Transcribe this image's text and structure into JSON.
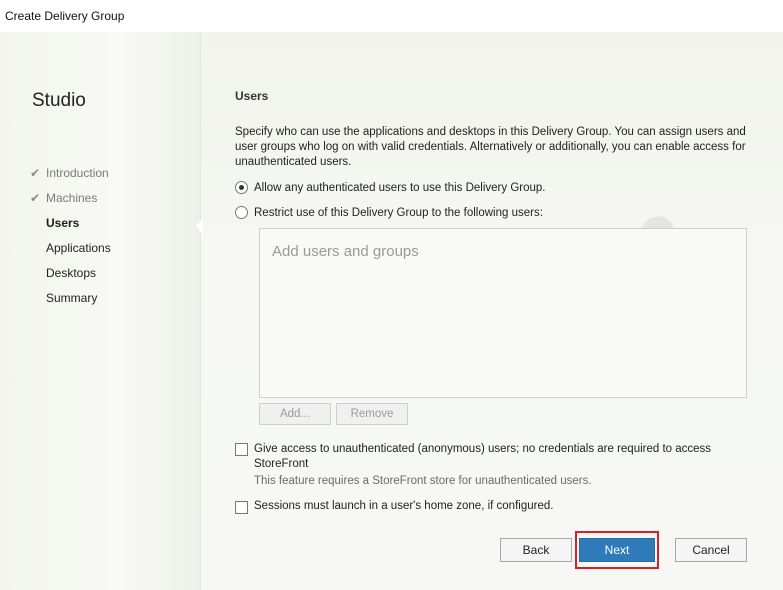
{
  "window": {
    "title": "Create Delivery Group"
  },
  "sidebar": {
    "brand": "Studio",
    "steps": [
      {
        "label": "Introduction",
        "state": "done",
        "icon": "checkmark-icon"
      },
      {
        "label": "Machines",
        "state": "done",
        "icon": "checkmark-icon"
      },
      {
        "label": "Users",
        "state": "current"
      },
      {
        "label": "Applications",
        "state": "pending"
      },
      {
        "label": "Desktops",
        "state": "pending"
      },
      {
        "label": "Summary",
        "state": "pending"
      }
    ]
  },
  "main": {
    "heading": "Users",
    "description": "Specify who can use the applications and desktops in this Delivery Group. You can assign users and user groups who log on with valid credentials. Alternatively or additionally, you can enable access for unauthenticated users.",
    "radio_any": {
      "label": "Allow any authenticated users to use this Delivery Group.",
      "selected": true
    },
    "radio_restrict": {
      "label": "Restrict use of this Delivery Group to the following users:",
      "selected": false
    },
    "users_box": {
      "placeholder": "Add users and groups"
    },
    "add_button": "Add...",
    "remove_button": "Remove",
    "anon_checkbox": {
      "label_line1": "Give access to unauthenticated (anonymous) users; no credentials are required to access",
      "label_line2": "StoreFront",
      "checked": false
    },
    "anon_note": "This feature requires a StoreFront store for unauthenticated users.",
    "home_zone_checkbox": {
      "label": "Sessions must launch in a user's home zone, if configured.",
      "checked": false
    }
  },
  "footer": {
    "back": "Back",
    "next": "Next",
    "cancel": "Cancel"
  },
  "colors": {
    "primary_button": "#2f7ab9",
    "highlight_border": "#d62128",
    "check_mark": "#8a8a8a"
  }
}
